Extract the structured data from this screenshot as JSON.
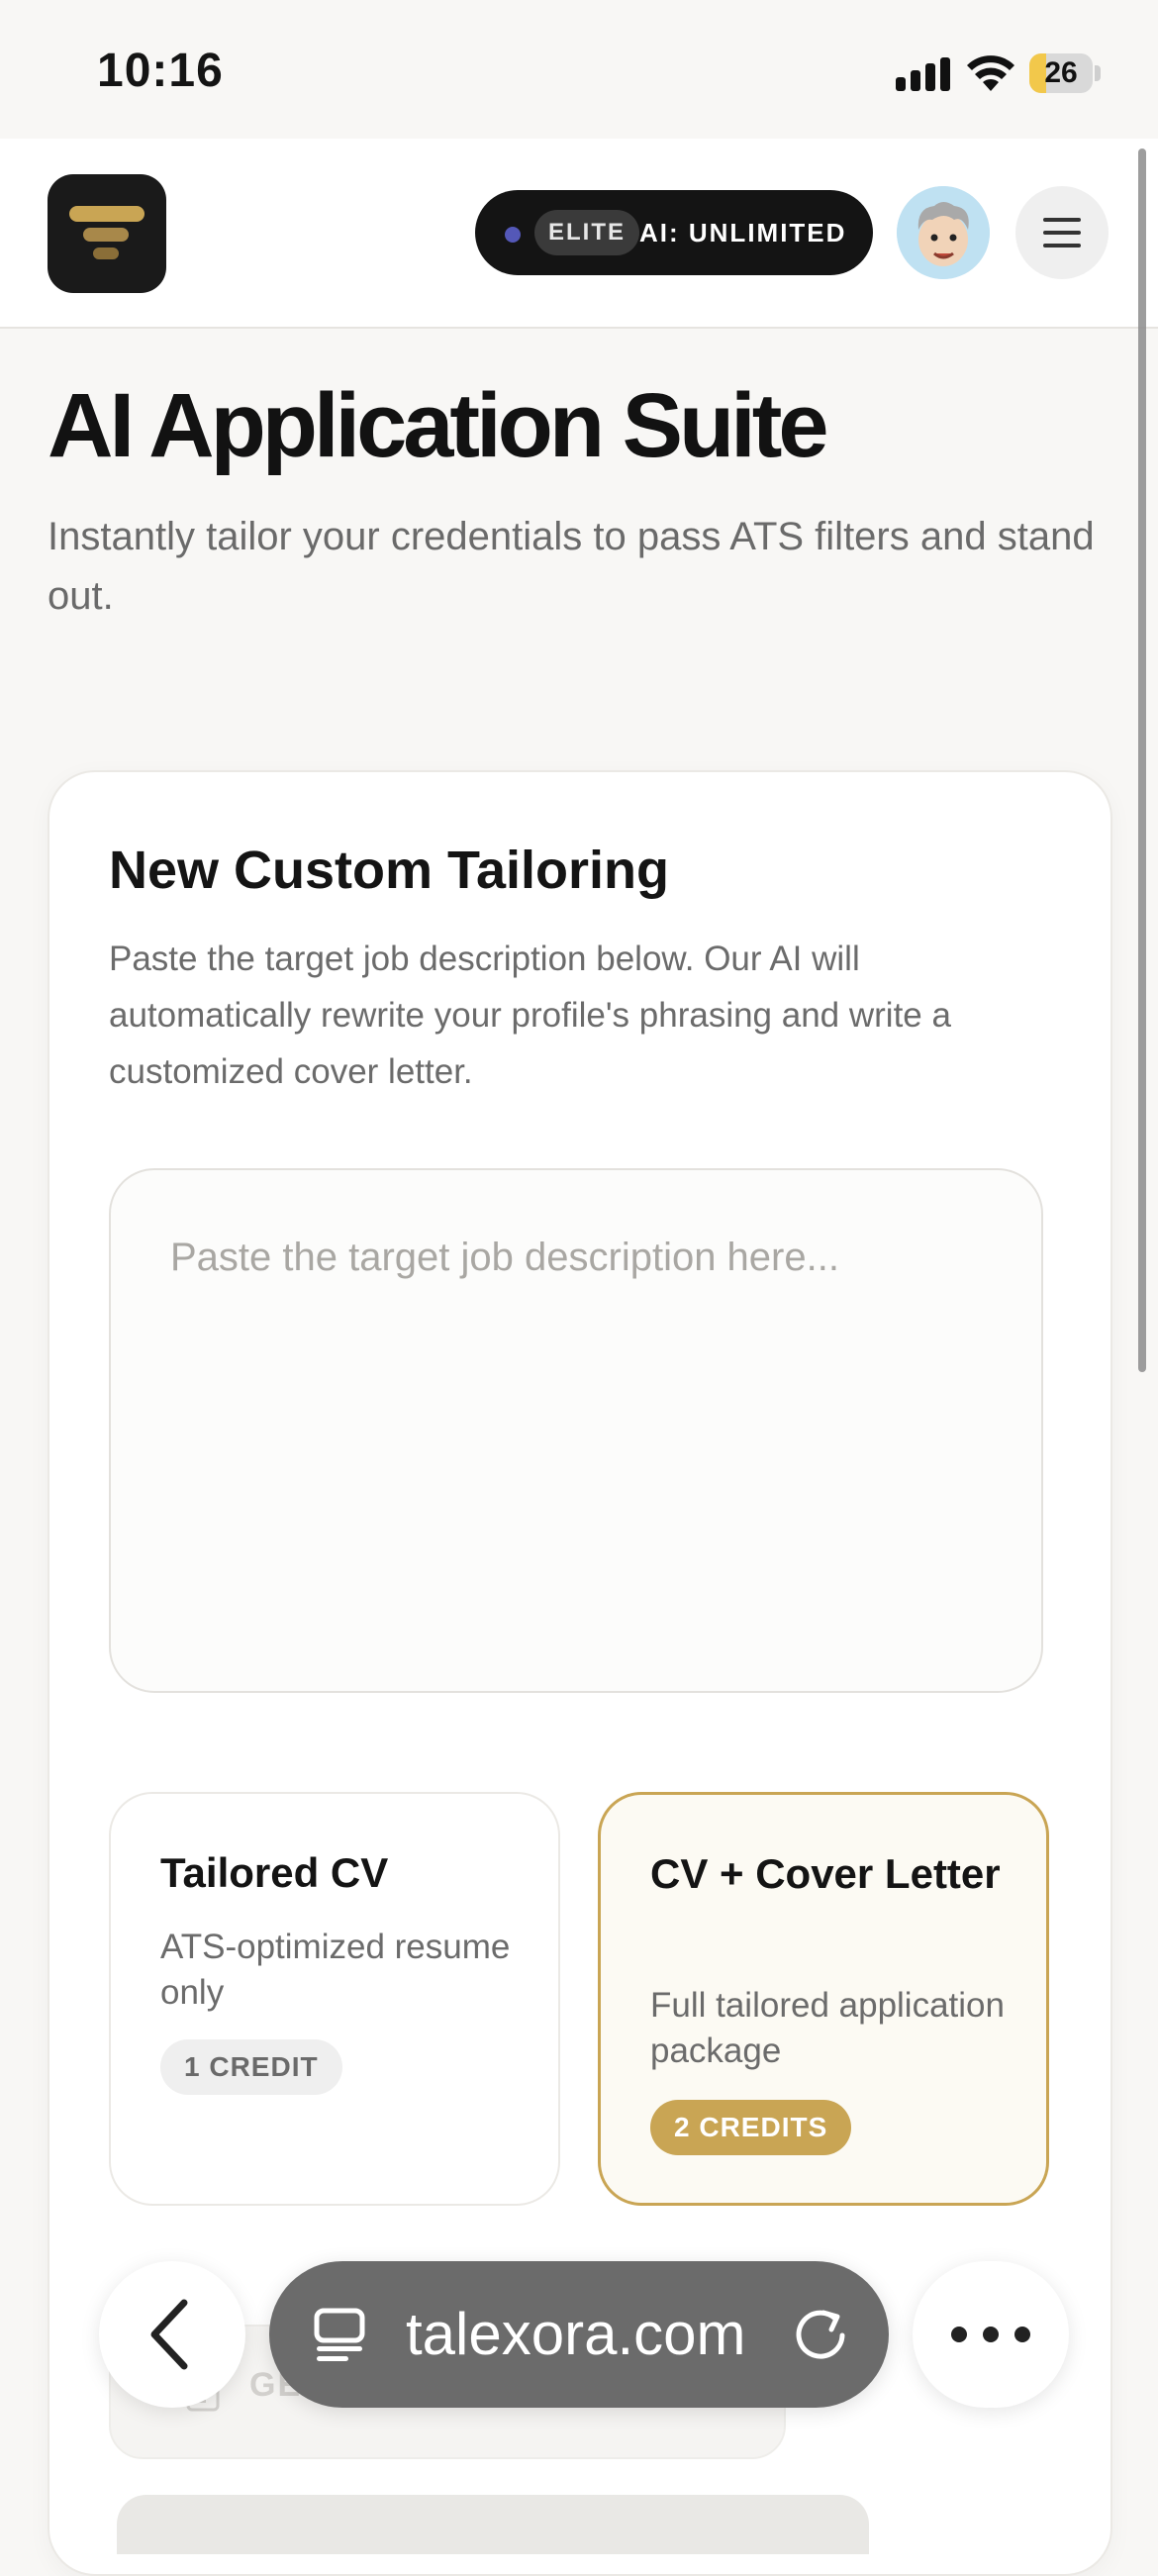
{
  "status_bar": {
    "time": "10:16",
    "battery_level": "26",
    "battery_fraction": 0.26
  },
  "header": {
    "plan_tier": "ELITE",
    "plan_ai": "AI: UNLIMITED"
  },
  "hero": {
    "title": "AI Application Suite",
    "subtitle": "Instantly tailor your credentials to pass ATS filters and stand out."
  },
  "card": {
    "title": "New Custom Tailoring",
    "description": "Paste the target job description below. Our AI will automatically rewrite your profile's phrasing and write a customized cover letter.",
    "textarea_placeholder": "Paste the target job description here...",
    "options": [
      {
        "title": "Tailored CV",
        "description": "ATS-optimized resume only",
        "badge": "1 CREDIT",
        "selected": false
      },
      {
        "title": "CV + Cover Letter",
        "description": "Full tailored application package",
        "badge": "2 CREDITS",
        "selected": true
      }
    ],
    "generate_label": "GE"
  },
  "browser": {
    "url": "talexora.com"
  },
  "colors": {
    "accent_gold": "#c9a554",
    "dark": "#141414",
    "plan_dot": "#5458b8"
  },
  "icons": [
    "signal-icon",
    "wifi-icon",
    "battery-icon",
    "app-logo-icon",
    "avatar-icon",
    "hamburger-menu-icon",
    "back-chevron-icon",
    "tabs-icon",
    "reload-icon",
    "more-icon",
    "document-icon"
  ]
}
